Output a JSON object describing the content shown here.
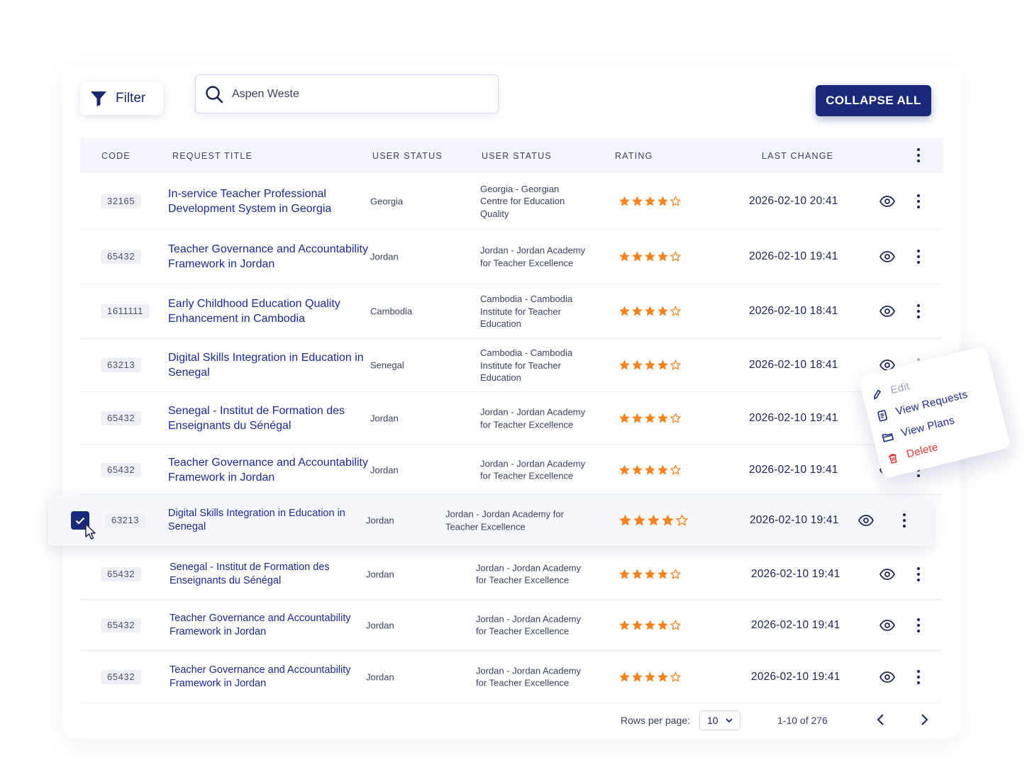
{
  "toolbar": {
    "filter_label": "Filter",
    "search_value": "Aspen Weste",
    "collapse_label": "COLLAPSE ALL"
  },
  "table": {
    "columns": [
      "CODE",
      "REQUEST TITLE",
      "USER STATUS",
      "USER STATUS",
      "RATING",
      "LAST CHANGE"
    ],
    "rows": [
      {
        "code": "32165",
        "title": "In-service Teacher Professional Development System in Georgia",
        "status": "Georgia",
        "org": "Georgia - Georgian Centre for Education Quality",
        "rating": 4,
        "date": "2026-02-10 20:41"
      },
      {
        "code": "65432",
        "title": "Teacher Governance and Accountability Framework in Jordan",
        "status": "Jordan",
        "org": "Jordan - Jordan Academy for Teacher Excellence",
        "rating": 4,
        "date": "2026-02-10 19:41"
      },
      {
        "code": "1611111",
        "title": "Early Childhood Education Quality Enhancement in Cambodia",
        "status": "Cambodia",
        "org": "Cambodia - Cambodia Institute for Teacher Education",
        "rating": 4,
        "date": "2026-02-10 18:41"
      },
      {
        "code": "63213",
        "title": "Digital Skills Integration in Education in Senegal",
        "status": "Senegal",
        "org": "Cambodia - Cambodia Institute for Teacher Education",
        "rating": 4,
        "date": "2026-02-10 18:41"
      },
      {
        "code": "65432",
        "title": "Senegal - Institut de Formation des Enseignants du Sénégal",
        "status": "Jordan",
        "org": "Jordan - Jordan Academy for Teacher Excellence",
        "rating": 4,
        "date": "2026-02-10 19:41"
      },
      {
        "code": "65432",
        "title": "Teacher Governance and Accountability Framework in Jordan",
        "status": "Jordan",
        "org": "Jordan - Jordan Academy for Teacher Excellence",
        "rating": 4,
        "date": "2026-02-10 19:41"
      },
      {
        "code": "63213",
        "title": "Digital Skills Integration in Education in Senegal",
        "status": "Jordan",
        "org": "Jordan - Jordan Academy for Teacher Excellence",
        "rating": 4,
        "date": "2026-02-10 19:41",
        "selected": true
      },
      {
        "code": "65432",
        "title": "Senegal - Institut de Formation des Enseignants du Sénégal",
        "status": "Jordan",
        "org": "Jordan - Jordan Academy for Teacher Excellence",
        "rating": 4,
        "date": "2026-02-10 19:41"
      },
      {
        "code": "65432",
        "title": "Teacher Governance and Accountability Framework in Jordan",
        "status": "Jordan",
        "org": "Jordan - Jordan Academy for Teacher Excellence",
        "rating": 4,
        "date": "2026-02-10 19:41"
      },
      {
        "code": "65432",
        "title": "Teacher Governance and Accountability Framework in Jordan",
        "status": "Jordan",
        "org": "Jordan - Jordan Academy for Teacher Excellence",
        "rating": 4,
        "date": "2026-02-10 19:41"
      }
    ]
  },
  "context_menu": {
    "items": [
      {
        "label": "Edit",
        "icon": "pencil-icon"
      },
      {
        "label": "View Requests",
        "icon": "document-icon"
      },
      {
        "label": "View Plans",
        "icon": "folder-icon"
      },
      {
        "label": "Delete",
        "icon": "trash-icon"
      }
    ]
  },
  "pagination": {
    "rows_per_page_label": "Rows per page:",
    "rows_per_page_value": "10",
    "range_label": "1-10 of 276"
  },
  "colors": {
    "primary": "#1a2a78",
    "link": "#1c2b8e",
    "star": "#f5841f",
    "danger": "#e23a3a"
  }
}
